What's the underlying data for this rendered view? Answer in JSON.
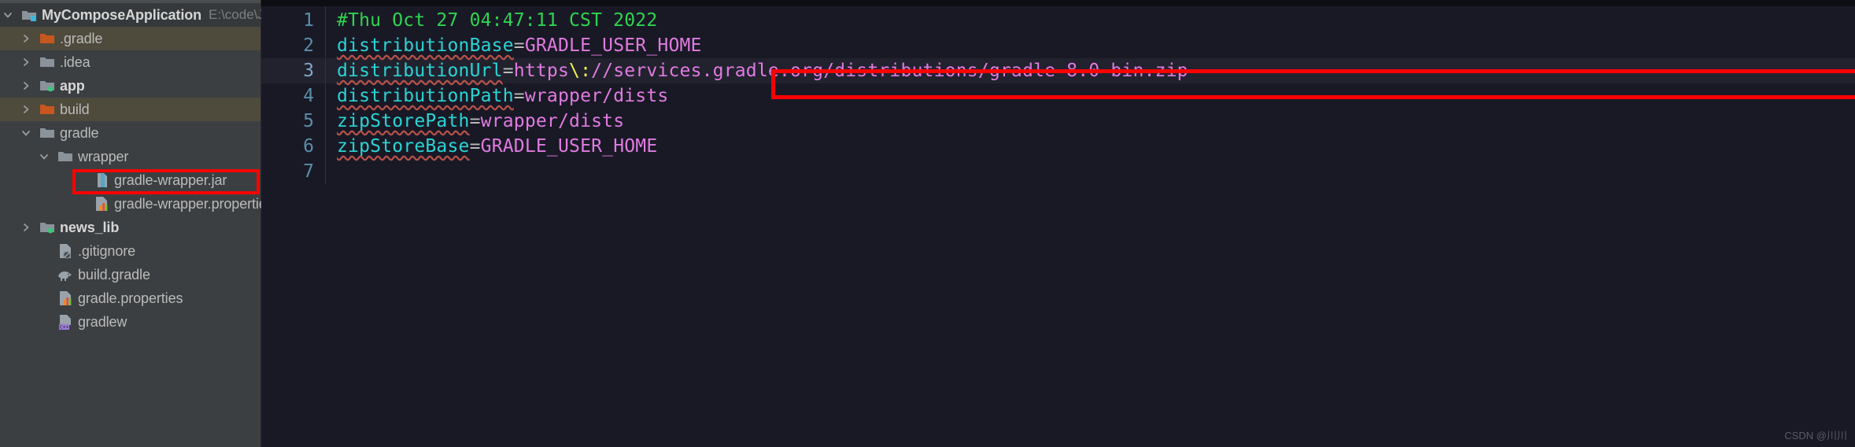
{
  "sidebar": {
    "project": {
      "name": "MyComposeApplication",
      "path": "E:\\code\\Je",
      "icon": "module-folder-icon",
      "arrow": "chevron-down-icon"
    },
    "items": [
      {
        "label": ".gradle",
        "indent": 1,
        "arrow": "chevron-right-icon",
        "icon": "folder-orange-icon",
        "selected": true,
        "bold": false
      },
      {
        "label": ".idea",
        "indent": 1,
        "arrow": "chevron-right-icon",
        "icon": "folder-gray-icon",
        "selected": false,
        "bold": false
      },
      {
        "label": "app",
        "indent": 1,
        "arrow": "chevron-right-icon",
        "icon": "module-folder-icon",
        "selected": false,
        "bold": true
      },
      {
        "label": "build",
        "indent": 1,
        "arrow": "chevron-right-icon",
        "icon": "folder-orange-icon",
        "selected": true,
        "bold": false
      },
      {
        "label": "gradle",
        "indent": 1,
        "arrow": "chevron-down-icon",
        "icon": "folder-gray-icon",
        "selected": false,
        "bold": false
      },
      {
        "label": "wrapper",
        "indent": 2,
        "arrow": "chevron-down-icon",
        "icon": "folder-gray-icon",
        "selected": false,
        "bold": false
      },
      {
        "label": "gradle-wrapper.jar",
        "indent": 4,
        "arrow": "none",
        "icon": "jar-file-icon",
        "selected": false,
        "bold": false
      },
      {
        "label": "gradle-wrapper.properties",
        "indent": 4,
        "arrow": "none",
        "icon": "properties-file-icon",
        "selected": false,
        "bold": false,
        "annotated": true
      },
      {
        "label": "news_lib",
        "indent": 1,
        "arrow": "chevron-right-icon",
        "icon": "module-folder-icon",
        "selected": false,
        "bold": true
      },
      {
        "label": ".gitignore",
        "indent": 2,
        "arrow": "none",
        "icon": "gitignore-file-icon",
        "selected": false,
        "bold": false
      },
      {
        "label": "build.gradle",
        "indent": 2,
        "arrow": "none",
        "icon": "gradle-file-icon",
        "selected": false,
        "bold": false
      },
      {
        "label": "gradle.properties",
        "indent": 2,
        "arrow": "none",
        "icon": "properties-file-icon",
        "selected": false,
        "bold": false
      },
      {
        "label": "gradlew",
        "indent": 2,
        "arrow": "none",
        "icon": "cpp-file-icon",
        "selected": false,
        "bold": false
      }
    ]
  },
  "editor": {
    "lines": [
      {
        "num": "1",
        "current": false,
        "tokens": [
          {
            "type": "comment",
            "text": "#Thu Oct 27 04:47:11 CST 2022"
          }
        ]
      },
      {
        "num": "2",
        "current": false,
        "tokens": [
          {
            "type": "key",
            "text": "distributionBase"
          },
          {
            "type": "eq",
            "text": "="
          },
          {
            "type": "val",
            "text": "GRADLE_USER_HOME"
          }
        ]
      },
      {
        "num": "3",
        "current": true,
        "tokens": [
          {
            "type": "key",
            "text": "distributionUrl"
          },
          {
            "type": "eq",
            "text": "="
          },
          {
            "type": "val",
            "text": "https"
          },
          {
            "type": "esc",
            "text": "\\:"
          },
          {
            "type": "val",
            "text": "//services.gradle.org/distributions/gradle-8.0-bin.zip"
          }
        ]
      },
      {
        "num": "4",
        "current": false,
        "tokens": [
          {
            "type": "key",
            "text": "distributionPath"
          },
          {
            "type": "eq",
            "text": "="
          },
          {
            "type": "val",
            "text": "wrapper/dists"
          }
        ]
      },
      {
        "num": "5",
        "current": false,
        "tokens": [
          {
            "type": "key",
            "text": "zipStorePath"
          },
          {
            "type": "eq",
            "text": "="
          },
          {
            "type": "val",
            "text": "wrapper/dists"
          }
        ]
      },
      {
        "num": "6",
        "current": false,
        "tokens": [
          {
            "type": "key",
            "text": "zipStoreBase"
          },
          {
            "type": "eq",
            "text": "="
          },
          {
            "type": "val",
            "text": "GRADLE_USER_HOME"
          }
        ]
      },
      {
        "num": "7",
        "current": false,
        "tokens": []
      }
    ]
  },
  "annotations": {
    "color": "#ff0000"
  },
  "watermark": "CSDN @川川"
}
